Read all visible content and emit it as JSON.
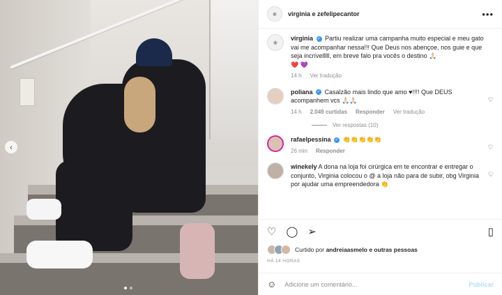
{
  "header": {
    "author": "virginia e zefelipecantor",
    "more": "•••"
  },
  "caption": {
    "user": "virginia",
    "text": "Partiu realizar uma campanha muito especial e meu gato vai me acompanhar nessa!!! Que Deus nos abençoe, nos guie e que seja incrívelllll, em breve falo pra vocês o destino 🙏🏻",
    "emoji_line": "❤️ 💜",
    "time": "14 h",
    "translate": "Ver tradução"
  },
  "comments": [
    {
      "user": "poliana",
      "verified": true,
      "text": "Casalzão mais lindo que amo ♥!!!! Que DEUS acompanhem vcs 🙏🏻🙏🏻",
      "time": "14 h",
      "likes": "2.049 curtidas",
      "reply": "Responder",
      "translate": "Ver tradução"
    },
    {
      "user": "rafaelpessina",
      "verified": true,
      "text": "👏👏👏👏👏",
      "time": "26 min",
      "reply": "Responder"
    },
    {
      "user": "winekely",
      "verified": false,
      "text": "A dona na loja foi cirúrgica em te encontrar e entregar o conjunto, Virginia colocou o @ a loja não para de subir, obg Virginia por ajudar uma empreendedora 👏"
    }
  ],
  "view_replies": "Ver respostas (10)",
  "likes": {
    "label": "Curtido por",
    "user": "andreiaasmelo",
    "rest": "e outras pessoas"
  },
  "post_time": "HÁ 14 HORAS",
  "add_comment": {
    "placeholder": "Adicione um comentário...",
    "publish": "Publicar"
  },
  "icons": {
    "like": "heart-icon",
    "comment": "comment-icon",
    "share": "share-icon",
    "save": "bookmark-icon",
    "emoji": "emoji-icon"
  }
}
